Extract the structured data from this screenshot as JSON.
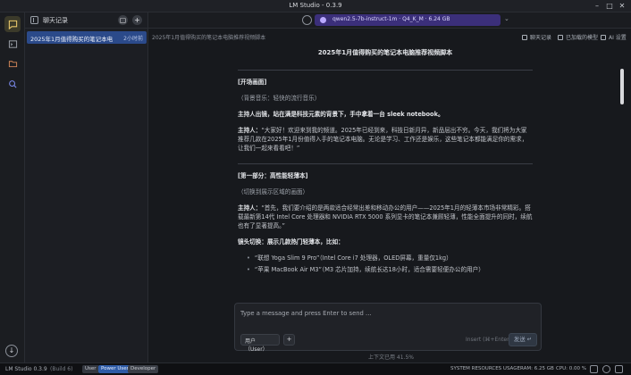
{
  "window": {
    "title": "LM Studio - 0.3.9"
  },
  "sidebar": {
    "header_label": "聊天记录",
    "chats": [
      {
        "title": "2025年1月值得购买的笔记本电脑...",
        "date": "2小时前"
      }
    ]
  },
  "toolbar": {
    "model": "qwen2.5-7b-instruct-1m · Q4_K_M · 6.24 GB",
    "links": [
      "聊天记录",
      "已加载的模型",
      "AI 设置"
    ]
  },
  "breadcrumb": "2025年1月值得购买的笔记本电脑推荐视频脚本",
  "document": {
    "title": "2025年1月值得购买的笔记本电脑推荐视频脚本",
    "sections": [
      {
        "kind": "sect",
        "text": "[开场画面]"
      },
      {
        "kind": "muted",
        "text": "（背景音乐：轻快的流行音乐）"
      },
      {
        "kind": "bold",
        "text": "主持人出镜，站在满是科技元素的背景下，手中拿着一台 sleek notebook。"
      },
      {
        "kind": "para",
        "label": "主持人：",
        "text": "“大家好！欢迎来到我的频道。2025年已经到来，科技日新月异，新品层出不穷。今天，我们将为大家推荐几款在2025年1月份值得入手的笔记本电脑。无论是学习、工作还是娱乐，这些笔记本都能满足你的需求，让我们一起来看看吧！”"
      },
      {
        "kind": "sect",
        "text": "[第一部分：高性能轻薄本]"
      },
      {
        "kind": "muted",
        "text": "（切换到展示区域的画面）"
      },
      {
        "kind": "para",
        "label": "主持人：",
        "text": "“首先，我们要介绍的是两款适合经常出差和移动办公的用户——2025年1月的轻薄本市场非常精彩。搭载最新第14代 Intel Core 处理器和 NVIDIA RTX 5000 系列显卡的笔记本兼顾轻薄，性能全面提升的同时，续航也有了显著提高。”"
      },
      {
        "kind": "bold",
        "text": "镜头切换：展示几款热门轻薄本，比如："
      }
    ],
    "list": [
      "“联想 Yoga Slim 9 Pro”（Intel Core i7 处理器，OLED屏幕，重量仅1kg）",
      "“苹果 MacBook Air M3”（M3 芯片加持，续航长达18小时，适合需要轻便办公的用户）"
    ]
  },
  "composer": {
    "placeholder": "Type a message and press Enter to send ...",
    "role": "用户（User）",
    "attach": "+",
    "hint": "Insert (⌘+Enter)",
    "send": "发送 ↵"
  },
  "context": "上下文已用 41.5%",
  "statusbar": {
    "app": "LM Studio 0.3.9",
    "build": "(Build 6)",
    "mode_user": "User",
    "mode_power": "Power User",
    "mode_dev": "Developer",
    "right": [
      "SYSTEM RESOURCES USAGE:",
      "RAM: 6.25 GB",
      "CPU: 0.00 %"
    ]
  }
}
